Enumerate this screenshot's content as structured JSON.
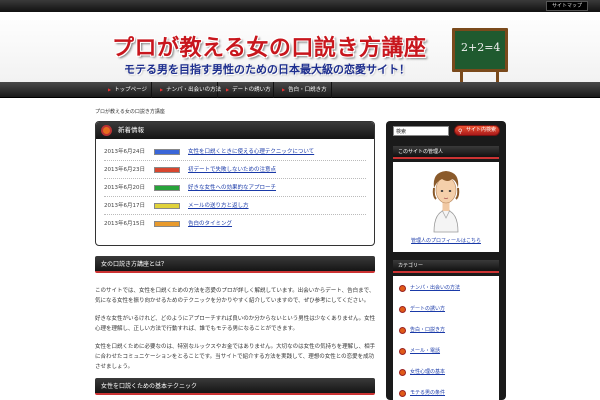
{
  "topbar": {
    "button_label": "サイトマップ"
  },
  "header": {
    "title": "プロが教える女の口説き方講座",
    "tagline": "モテる男を目指す男性のための日本最大級の恋愛サイト！",
    "board_text": "2+2=4"
  },
  "nav": {
    "items": [
      {
        "label": "トップページ"
      },
      {
        "label": "ナンパ・出会いの方法"
      },
      {
        "label": "デートの誘い方"
      },
      {
        "label": "告白・口説き方"
      }
    ]
  },
  "breadcrumb": "プロが教える女の口説き方講座",
  "news": {
    "title": "新着情報",
    "items": [
      {
        "date": "2013年6月24日",
        "badge_color": "#3a66d8",
        "text": "女性を口説くときに使える心理テクニックについて"
      },
      {
        "date": "2013年6月23日",
        "badge_color": "#d8462e",
        "text": "初デートで失敗しないための注意点"
      },
      {
        "date": "2013年6月20日",
        "badge_color": "#27a33a",
        "text": "好きな女性への効果的なアプローチ"
      },
      {
        "date": "2013年6月17日",
        "badge_color": "#e0d23a",
        "text": "メールの送り方と返し方"
      },
      {
        "date": "2013年6月15日",
        "badge_color": "#e89a2c",
        "text": "告白のタイミング"
      }
    ]
  },
  "intro": {
    "title": "女の口説き方講座とは？",
    "paragraphs": [
      "このサイトでは、女性を口説くための方法を恋愛のプロが詳しく解説しています。出会いからデート、告白まで、気になる女性を振り向かせるためのテクニックを分かりやすく紹介していますので、ぜひ参考にしてください。",
      "好きな女性がいるけれど、どのようにアプローチすれば良いのか分からないという男性は少なくありません。女性心理を理解し、正しい方法で行動すれば、誰でもモテる男になることができます。",
      "女性を口説くために必要なのは、特別なルックスやお金ではありません。大切なのは女性の気持ちを理解し、相手に合わせたコミュニケーションをとることです。当サイトで紹介する方法を実践して、理想の女性との恋愛を成功させましょう。"
    ]
  },
  "section2": {
    "title": "女性を口説くための基本テクニック"
  },
  "sidebar": {
    "search_placeholder": "",
    "search_value": "検索",
    "search_button": "サイト内検索",
    "profile_title": "このサイトの管理人",
    "profile_link": "管理人のプロフィールはこちら",
    "categories_title": "カテゴリー",
    "categories": [
      {
        "label": "ナンパ・出会いの方法"
      },
      {
        "label": "デートの誘い方"
      },
      {
        "label": "告白・口説き方"
      },
      {
        "label": "メール・電話"
      },
      {
        "label": "女性心理の基本"
      },
      {
        "label": "モテる男の条件"
      },
      {
        "label": "恋愛テクニック"
      }
    ]
  }
}
